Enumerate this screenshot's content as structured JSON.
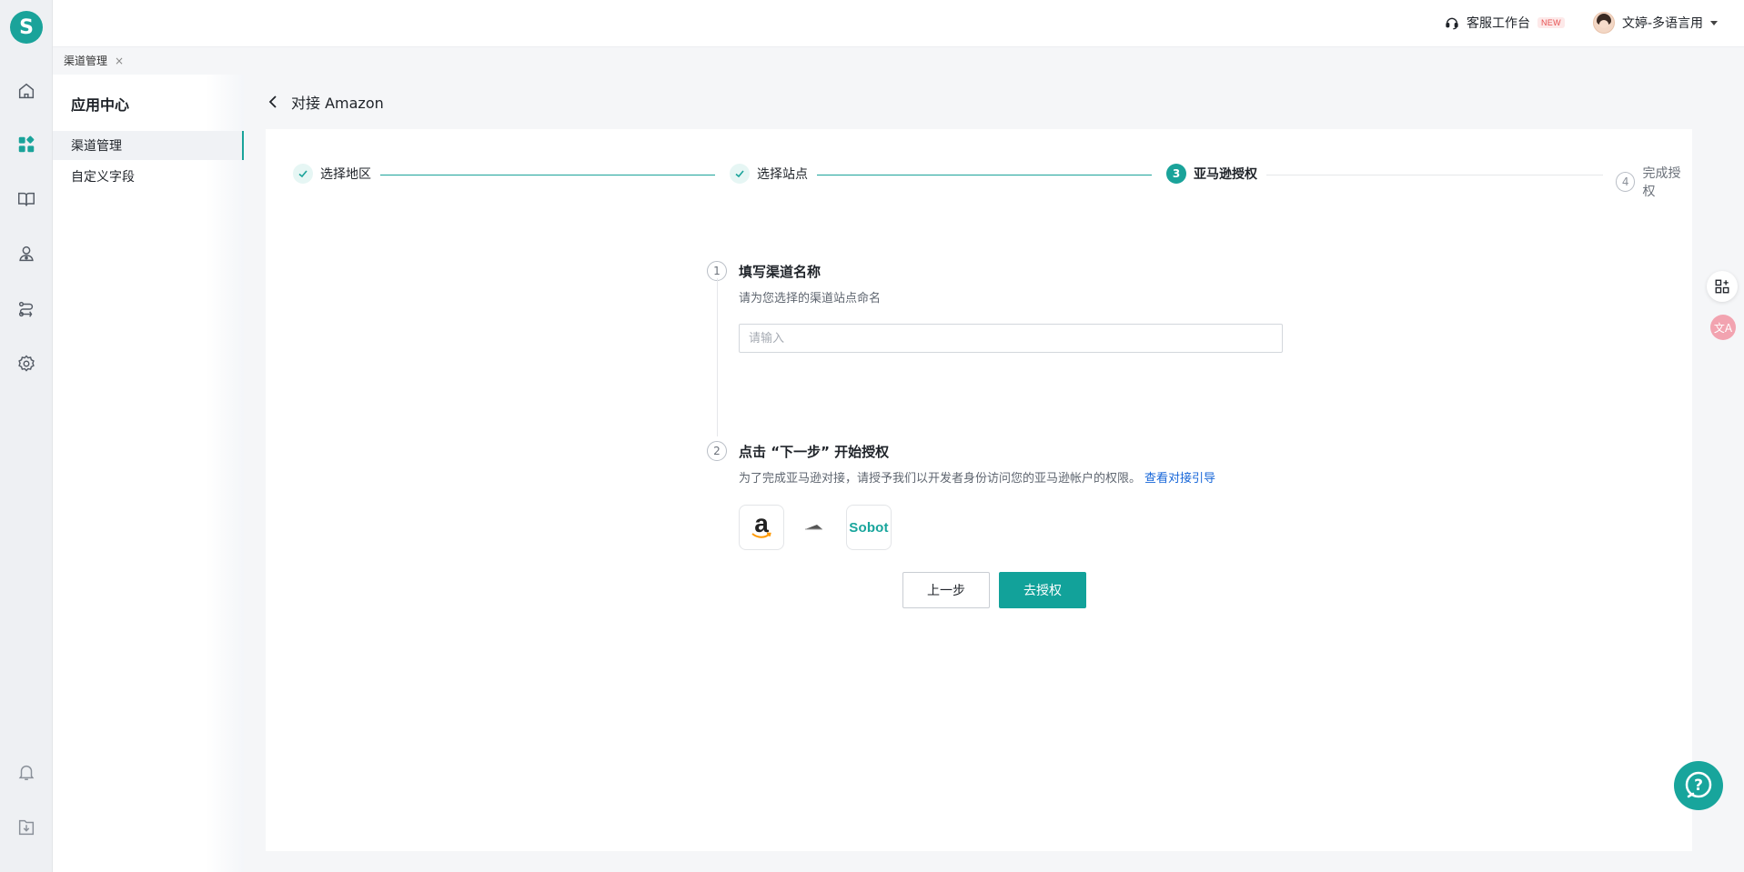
{
  "app": {
    "logo_letter": "S",
    "brand_color": "#1aa39a"
  },
  "rail": {
    "items": [
      {
        "icon": "home-icon"
      },
      {
        "icon": "apps-grid-icon",
        "active": true
      },
      {
        "icon": "book-icon"
      },
      {
        "icon": "customer-icon"
      },
      {
        "icon": "route-icon"
      },
      {
        "icon": "gear-icon"
      },
      {
        "icon": "bell-icon"
      },
      {
        "icon": "download-icon"
      }
    ]
  },
  "header": {
    "workspace_label": "客服工作台",
    "workspace_badge": "NEW",
    "user_name": "文婷-多语言用"
  },
  "tabs": [
    {
      "label": "渠道管理",
      "close": "×"
    }
  ],
  "sidebar": {
    "title": "应用中心",
    "items": [
      {
        "label": "渠道管理",
        "active": true
      },
      {
        "label": "自定义字段",
        "active": false
      }
    ]
  },
  "page": {
    "title": "对接 Amazon"
  },
  "steps": [
    {
      "index": "1",
      "label": "选择地区",
      "status": "done"
    },
    {
      "index": "2",
      "label": "选择站点",
      "status": "done"
    },
    {
      "index": "3",
      "label": "亚马逊授权",
      "status": "active"
    },
    {
      "index": "4",
      "label": "完成授权",
      "status": "todo"
    }
  ],
  "section1": {
    "num": "1",
    "title": "填写渠道名称",
    "desc": "请为您选择的渠道站点命名",
    "input_placeholder": "请输入",
    "input_value": ""
  },
  "section2": {
    "num": "2",
    "title": "点击 “下一步” 开始授权",
    "desc": "为了完成亚马逊对接，请授予我们以开发者身份访问您的亚马逊帐户的权限。",
    "link": "查看对接引导",
    "from_logo": "a",
    "to_logo": "Sobot"
  },
  "actions": {
    "prev_label": "上一步",
    "authorize_label": "去授权"
  },
  "floating": {
    "help": "?",
    "translate": "文A"
  }
}
